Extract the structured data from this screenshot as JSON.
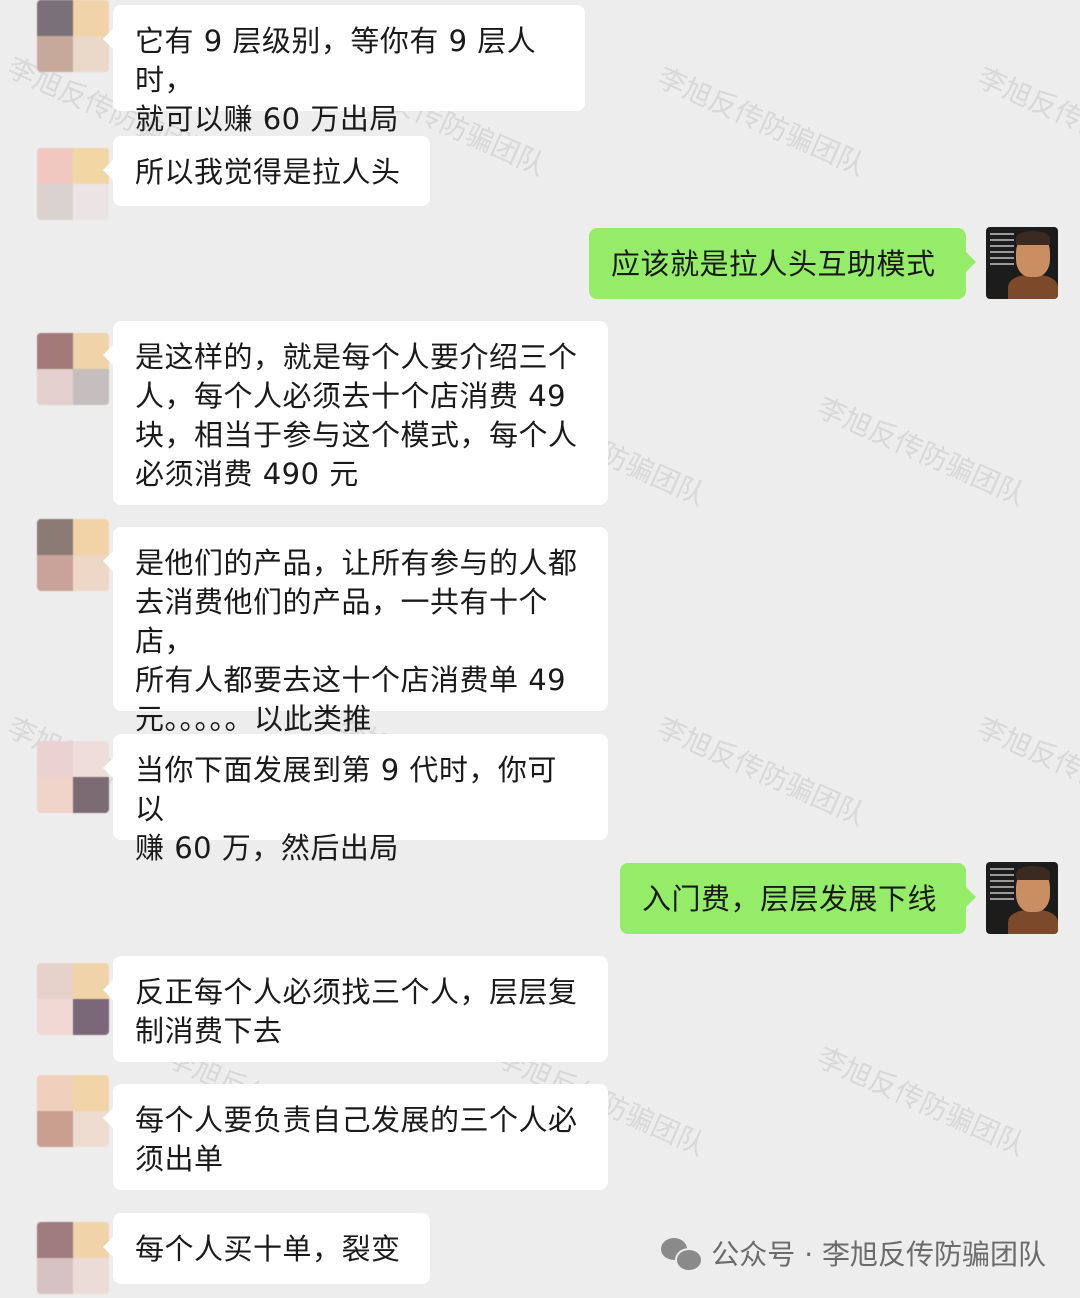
{
  "messages": [
    {
      "side": "left",
      "text": "它有 9 层级别，等你有 9 层人时，\n就可以赚 60 万出局"
    },
    {
      "side": "left",
      "text": "所以我觉得是拉人头"
    },
    {
      "side": "right",
      "text": "应该就是拉人头互助模式"
    },
    {
      "side": "left",
      "text": "是这样的，就是每个人要介绍三个\n人，每个人必须去十个店消费 49\n块，相当于参与这个模式，每个人\n必须消费 490 元"
    },
    {
      "side": "left",
      "text": "是他们的产品，让所有参与的人都\n去消费他们的产品，一共有十个店，\n所有人都要去这十个店消费单 49\n元。。。。。以此类推"
    },
    {
      "side": "left",
      "text": "当你下面发展到第 9 代时，你可以\n赚 60 万，然后出局"
    },
    {
      "side": "right",
      "text": "入门费，层层发展下线"
    },
    {
      "side": "left",
      "text": "反正每个人必须找三个人，层层复\n制消费下去"
    },
    {
      "side": "left",
      "text": "每个人要负责自己发展的三个人必\n须出单"
    },
    {
      "side": "left",
      "text": "每个人买十单，裂变"
    }
  ],
  "watermark_text": "李旭反传防骗团队",
  "footer": {
    "label": "公众号 · 李旭反传防骗团队"
  },
  "colors": {
    "background": "#ededed",
    "left_bubble": "#ffffff",
    "right_bubble": "#95ec69"
  }
}
